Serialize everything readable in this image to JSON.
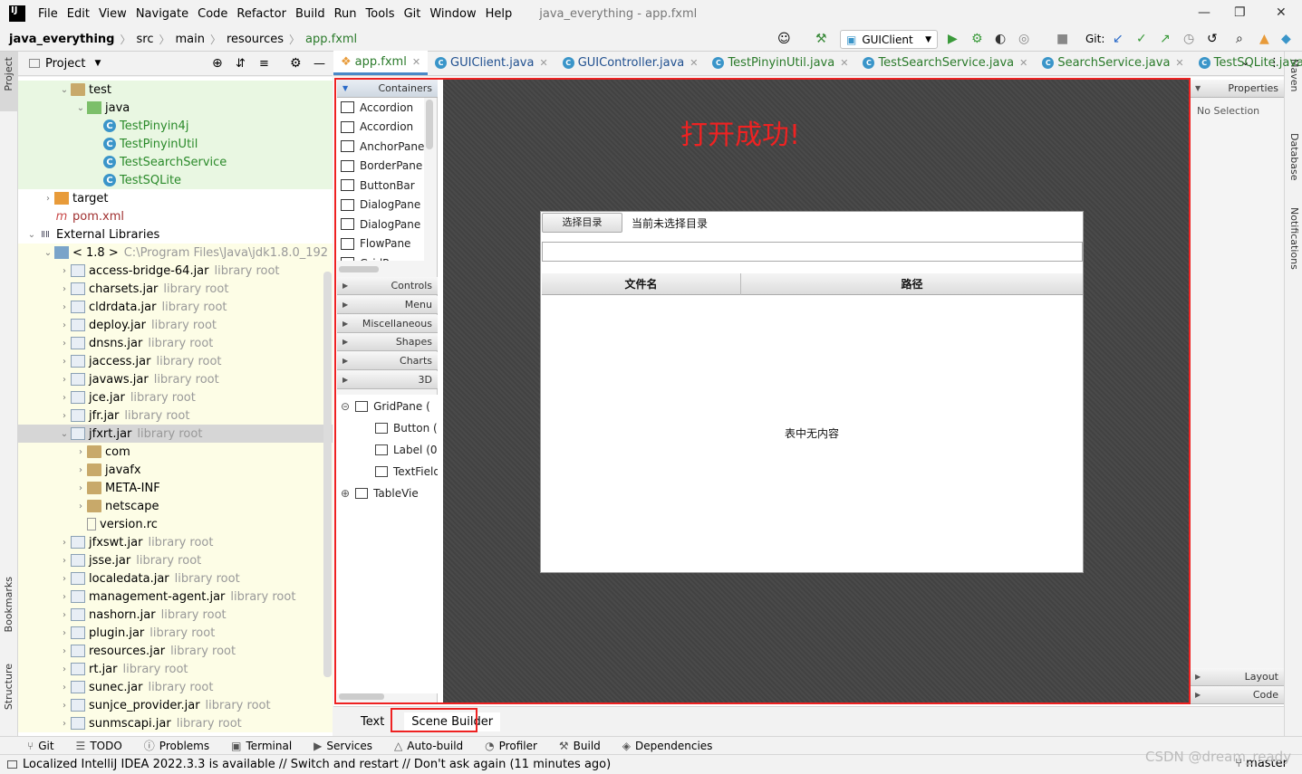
{
  "window": {
    "title": "java_everything - app.fxml",
    "menu": [
      "File",
      "Edit",
      "View",
      "Navigate",
      "Code",
      "Refactor",
      "Build",
      "Run",
      "Tools",
      "Git",
      "Window",
      "Help"
    ]
  },
  "breadcrumb": [
    "java_everything",
    "src",
    "main",
    "resources",
    "app.fxml"
  ],
  "run_config": "GUIClient",
  "git_label": "Git:",
  "tool_windows": {
    "left": [
      "Project",
      "Bookmarks",
      "Structure"
    ],
    "right": [
      "Maven",
      "Database",
      "Notifications"
    ]
  },
  "project_panel": {
    "title": "Project",
    "rows": [
      {
        "label": "test",
        "indent": 2,
        "arrow": "v",
        "icon": "folder"
      },
      {
        "label": "java",
        "indent": 3,
        "arrow": "v",
        "icon": "folder-green"
      },
      {
        "label": "TestPinyin4j",
        "indent": 4,
        "icon": "class"
      },
      {
        "label": "TestPinyinUtil",
        "indent": 4,
        "icon": "class"
      },
      {
        "label": "TestSearchService",
        "indent": 4,
        "icon": "class"
      },
      {
        "label": "TestSQLite",
        "indent": 4,
        "icon": "class"
      },
      {
        "label": "target",
        "indent": 1,
        "arrow": ">",
        "icon": "folder-orange"
      },
      {
        "label": "pom.xml",
        "indent": 1,
        "icon": "maven"
      },
      {
        "label": "External Libraries",
        "indent": 0,
        "arrow": "v",
        "icon": "libs"
      },
      {
        "label": "< 1.8 >",
        "suffix": "C:\\Program Files\\Java\\jdk1.8.0_192",
        "indent": 1,
        "arrow": "v",
        "icon": "folder-blue"
      },
      {
        "label": "access-bridge-64.jar",
        "suffix": "library root",
        "indent": 2,
        "arrow": ">",
        "icon": "jar"
      },
      {
        "label": "charsets.jar",
        "suffix": "library root",
        "indent": 2,
        "arrow": ">",
        "icon": "jar"
      },
      {
        "label": "cldrdata.jar",
        "suffix": "library root",
        "indent": 2,
        "arrow": ">",
        "icon": "jar"
      },
      {
        "label": "deploy.jar",
        "suffix": "library root",
        "indent": 2,
        "arrow": ">",
        "icon": "jar"
      },
      {
        "label": "dnsns.jar",
        "suffix": "library root",
        "indent": 2,
        "arrow": ">",
        "icon": "jar"
      },
      {
        "label": "jaccess.jar",
        "suffix": "library root",
        "indent": 2,
        "arrow": ">",
        "icon": "jar"
      },
      {
        "label": "javaws.jar",
        "suffix": "library root",
        "indent": 2,
        "arrow": ">",
        "icon": "jar"
      },
      {
        "label": "jce.jar",
        "suffix": "library root",
        "indent": 2,
        "arrow": ">",
        "icon": "jar"
      },
      {
        "label": "jfr.jar",
        "suffix": "library root",
        "indent": 2,
        "arrow": ">",
        "icon": "jar"
      },
      {
        "label": "jfxrt.jar",
        "suffix": "library root",
        "indent": 2,
        "arrow": "v",
        "icon": "jar",
        "selected": true
      },
      {
        "label": "com",
        "indent": 3,
        "arrow": ">",
        "icon": "folder"
      },
      {
        "label": "javafx",
        "indent": 3,
        "arrow": ">",
        "icon": "folder"
      },
      {
        "label": "META-INF",
        "indent": 3,
        "arrow": ">",
        "icon": "folder"
      },
      {
        "label": "netscape",
        "indent": 3,
        "arrow": ">",
        "icon": "folder"
      },
      {
        "label": "version.rc",
        "indent": 3,
        "icon": "file"
      },
      {
        "label": "jfxswt.jar",
        "suffix": "library root",
        "indent": 2,
        "arrow": ">",
        "icon": "jar"
      },
      {
        "label": "jsse.jar",
        "suffix": "library root",
        "indent": 2,
        "arrow": ">",
        "icon": "jar"
      },
      {
        "label": "localedata.jar",
        "suffix": "library root",
        "indent": 2,
        "arrow": ">",
        "icon": "jar"
      },
      {
        "label": "management-agent.jar",
        "suffix": "library root",
        "indent": 2,
        "arrow": ">",
        "icon": "jar"
      },
      {
        "label": "nashorn.jar",
        "suffix": "library root",
        "indent": 2,
        "arrow": ">",
        "icon": "jar"
      },
      {
        "label": "plugin.jar",
        "suffix": "library root",
        "indent": 2,
        "arrow": ">",
        "icon": "jar"
      },
      {
        "label": "resources.jar",
        "suffix": "library root",
        "indent": 2,
        "arrow": ">",
        "icon": "jar"
      },
      {
        "label": "rt.jar",
        "suffix": "library root",
        "indent": 2,
        "arrow": ">",
        "icon": "jar"
      },
      {
        "label": "sunec.jar",
        "suffix": "library root",
        "indent": 2,
        "arrow": ">",
        "icon": "jar"
      },
      {
        "label": "sunjce_provider.jar",
        "suffix": "library root",
        "indent": 2,
        "arrow": ">",
        "icon": "jar"
      },
      {
        "label": "sunmscapi.jar",
        "suffix": "library root",
        "indent": 2,
        "arrow": ">",
        "icon": "jar"
      }
    ]
  },
  "editor_tabs": [
    {
      "label": "app.fxml",
      "active": true,
      "icon": "fxml"
    },
    {
      "label": "GUIClient.java",
      "icon": "class"
    },
    {
      "label": "GUIController.java",
      "icon": "class"
    },
    {
      "label": "TestPinyinUtil.java",
      "icon": "class"
    },
    {
      "label": "TestSearchService.java",
      "icon": "class"
    },
    {
      "label": "SearchService.java",
      "icon": "class"
    },
    {
      "label": "TestSQLite.java",
      "icon": "class"
    }
  ],
  "scene_builder": {
    "library_sections": [
      "Containers",
      "Controls",
      "Menu",
      "Miscellaneous",
      "Shapes",
      "Charts",
      "3D"
    ],
    "containers": [
      "Accordion",
      "Accordion",
      "AnchorPane",
      "BorderPane",
      "ButtonBar",
      "DialogPane",
      "DialogPane",
      "FlowPane",
      "GridPane"
    ],
    "hierarchy": [
      {
        "label": "GridPane (",
        "indent": 0,
        "toggle": "-"
      },
      {
        "label": "Button (",
        "indent": 1
      },
      {
        "label": "Label (0,",
        "indent": 1
      },
      {
        "label": "TextField",
        "indent": 1
      },
      {
        "label": "TableVie",
        "indent": 0,
        "toggle": "+"
      }
    ],
    "annotation": "打开成功!",
    "preview": {
      "button": "选择目录",
      "label": "当前未选择目录",
      "columns": [
        "文件名",
        "路径"
      ],
      "empty": "表中无内容"
    },
    "inspector": {
      "sections": [
        "Properties",
        "Layout",
        "Code"
      ],
      "no_selection": "No Selection"
    }
  },
  "editor_bottom_tabs": [
    "Text",
    "Scene Builder"
  ],
  "tool_tabs": [
    {
      "icon": "git-icon",
      "label": "Git"
    },
    {
      "icon": "todo-icon",
      "label": "TODO"
    },
    {
      "icon": "problems-icon",
      "label": "Problems"
    },
    {
      "icon": "terminal-icon",
      "label": "Terminal"
    },
    {
      "icon": "services-icon",
      "label": "Services"
    },
    {
      "icon": "auto-build-icon",
      "label": "Auto-build"
    },
    {
      "icon": "profiler-icon",
      "label": "Profiler"
    },
    {
      "icon": "build-icon",
      "label": "Build"
    },
    {
      "icon": "dependencies-icon",
      "label": "Dependencies"
    }
  ],
  "status": {
    "message": "Localized IntelliJ IDEA 2022.3.3 is available // Switch and restart // Don't ask again (11 minutes ago)",
    "branch": "master",
    "watermark": "CSDN @dream_ready"
  },
  "colors": {
    "accent": "#4a88c7",
    "annotation": "#e22222",
    "tree_test_bg": "#e9f7e2",
    "tree_lib_bg": "#fdfde6",
    "selection": "#d6d6d6"
  }
}
